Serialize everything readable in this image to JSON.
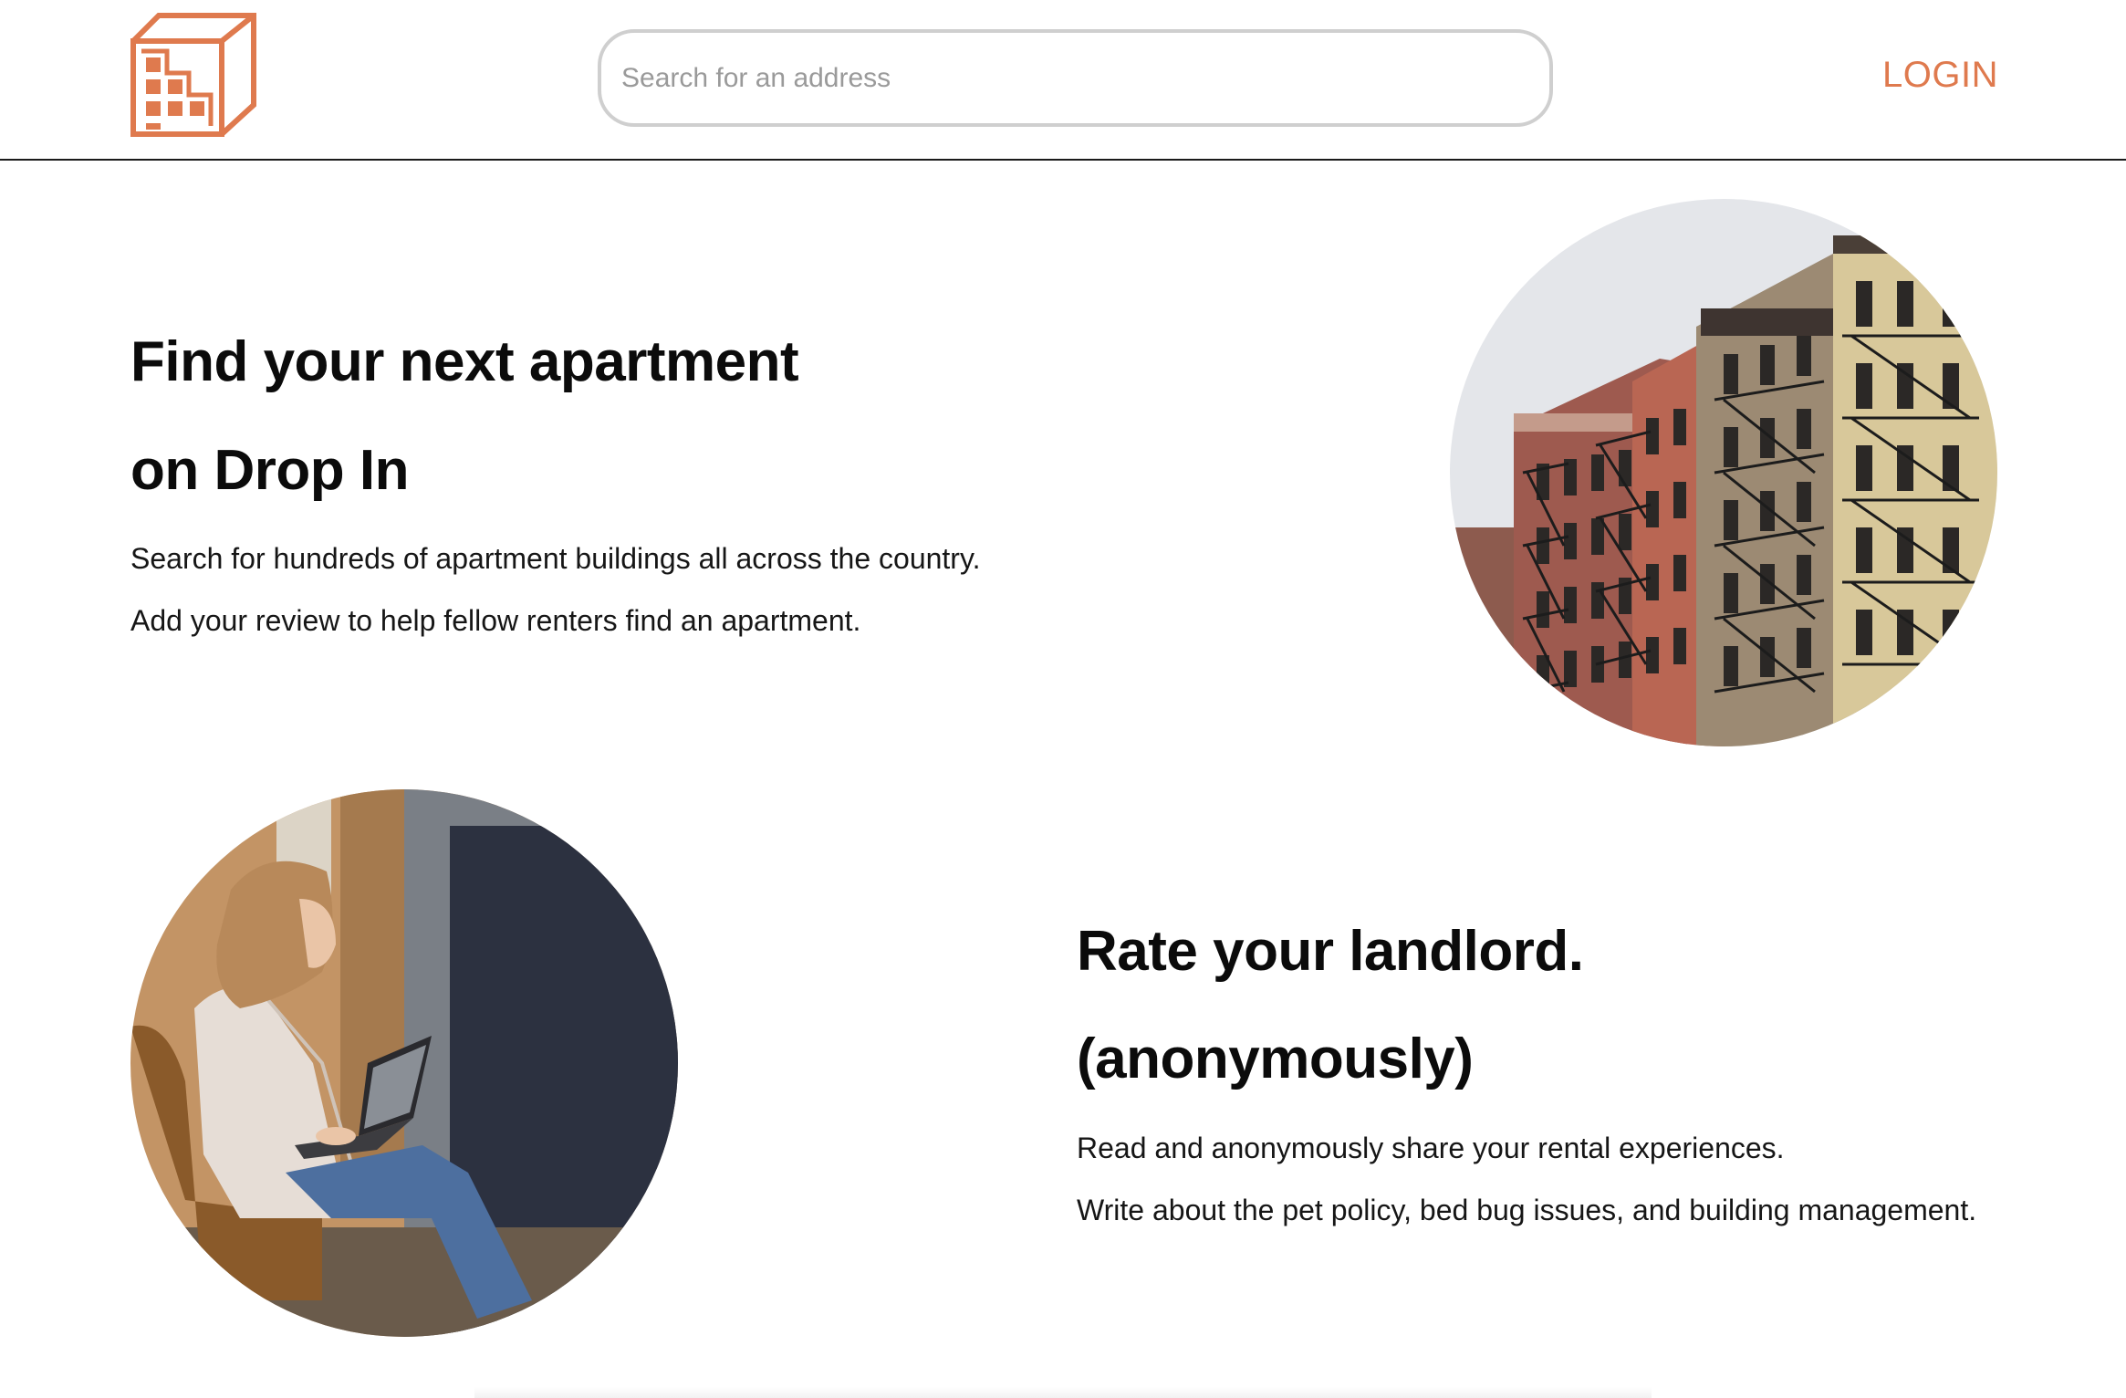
{
  "header": {
    "logo_icon": "building-logo-icon",
    "brand_color": "#df7a4e",
    "search": {
      "placeholder": "Search for an address",
      "value": ""
    },
    "login_label": "LOGIN"
  },
  "section_find": {
    "title_line1": "Find your next apartment",
    "title_line2": "on Drop In",
    "para1": "Search for hundreds of apartment buildings all across the country.",
    "para2": "Add your review to help fellow renters find an apartment.",
    "image": "apartment-buildings-photo"
  },
  "section_rate": {
    "title_line1": "Rate your landlord.",
    "title_line2": "(anonymously)",
    "para1": "Read and anonymously share your rental experiences.",
    "para2": "Write about the pet policy, bed bug issues, and building management.",
    "image": "woman-with-laptop-photo"
  }
}
